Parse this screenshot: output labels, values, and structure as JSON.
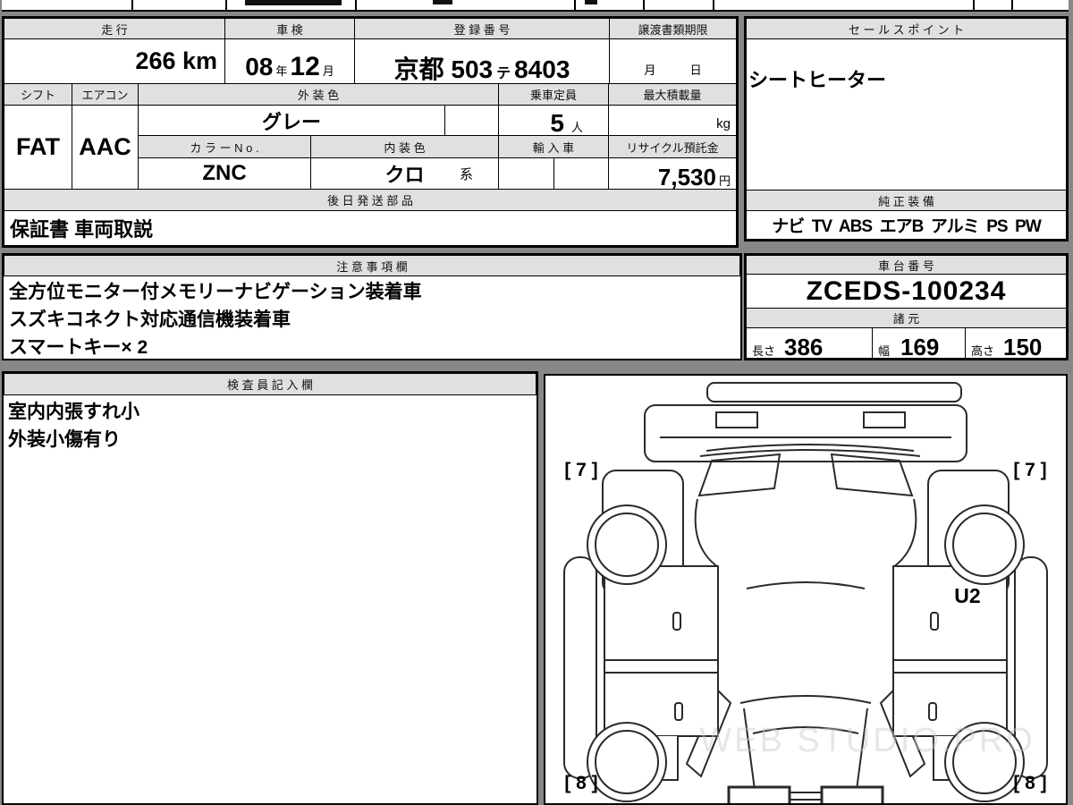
{
  "colors": {
    "page_bg": "#878787",
    "header_bg": "#e0e0e0",
    "cell_bg": "#ffffff",
    "border": "#000000",
    "diagram_line": "#2a2a2a",
    "watermark": "#c9c9c9"
  },
  "main_table": {
    "mileage_header": "走 行",
    "mileage_value": "266 km",
    "shaken_header": "車 検",
    "shaken_year": "08",
    "shaken_year_unit": "年",
    "shaken_month": "12",
    "shaken_month_unit": "月",
    "reg_header": "登 録 番 号",
    "reg_area": "京都 503",
    "reg_kana": "テ",
    "reg_number": "8403",
    "transfer_header": "譲渡書類期限",
    "transfer_month_unit": "月",
    "transfer_day_unit": "日",
    "shift_header": "シフト",
    "shift_value": "FAT",
    "aircon_header": "エアコン",
    "aircon_value": "AAC",
    "ext_color_header": "外 装 色",
    "ext_color_value": "グレー",
    "capacity_header": "乗車定員",
    "capacity_value": "5",
    "capacity_unit": "人",
    "payload_header": "最大積載量",
    "payload_unit": "kg",
    "color_no_header": "カ ラ ー N o .",
    "color_no_value": "ZNC",
    "int_color_header": "内 装 色",
    "int_color_value": "クロ",
    "int_color_suffix": "系",
    "import_header": "輸 入 車",
    "recycle_header": "リサイクル預託金",
    "recycle_value": "7,530",
    "recycle_unit": "円",
    "later_parts_header": "後 日 発 送 部 品",
    "later_parts_value": "保証書 車両取説"
  },
  "sales": {
    "header": "セ ー ル ス ポ イ ン ト",
    "value": "シートヒーター",
    "genuine_header": "純 正 装 備",
    "genuine_value": "ナビ  TV  ABS  エアB  アルミ  PS  PW"
  },
  "notes": {
    "header": "注 意 事 項 欄",
    "lines": [
      "全方位モニター付メモリーナビゲーション装着車",
      "スズキコネクト対応通信機装着車",
      "スマートキー× 2"
    ]
  },
  "chassis": {
    "header": "車 台 番 号",
    "value": "ZCEDS-100234",
    "specs_header": "諸 元",
    "length_label": "長さ",
    "length_value": "386",
    "width_label": "幅",
    "width_value": "169",
    "height_label": "高さ",
    "height_value": "150"
  },
  "inspector": {
    "header": "検 査 員 記 入 欄",
    "lines": [
      "室内内張すれ小",
      "外装小傷有り"
    ]
  },
  "diagram": {
    "label_front_left": "[ 7 ]",
    "label_front_right": "[ 7 ]",
    "label_rear_left": "[ 8 ]",
    "label_rear_right": "[ 8 ]",
    "mark_u2": "U2",
    "watermark": "WEB STUDIO.PRO"
  }
}
